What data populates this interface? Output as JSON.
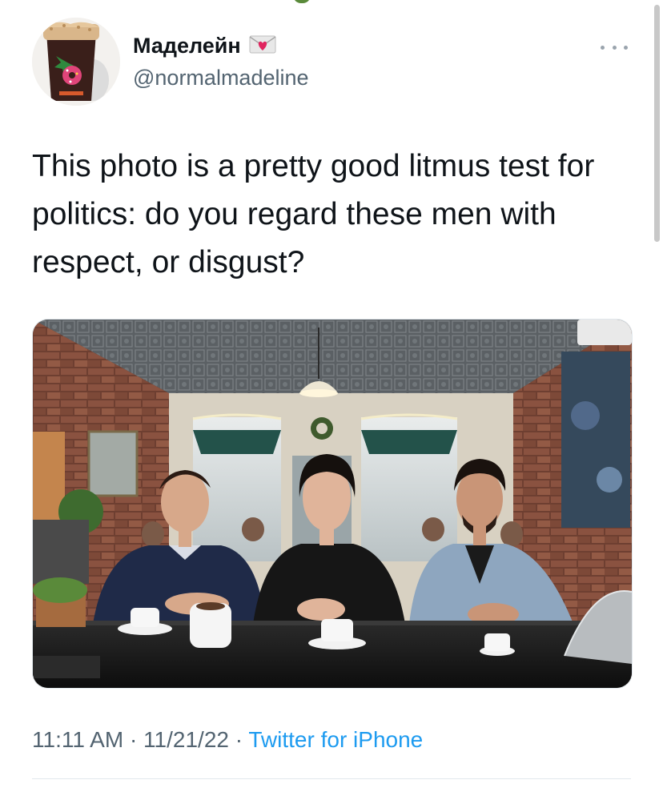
{
  "tweet": {
    "display_name": "Маделейн",
    "handle": "@normalmadeline",
    "text": "This photo is a pretty good litmus test for politics: do you regard these men with respect, or disgust?",
    "time": "11:11 AM",
    "date": "11/21/22",
    "separator": "·",
    "source": "Twitter for iPhone"
  },
  "icons": {
    "badge": "heart-envelope-icon",
    "more": "more-dots-icon",
    "avatar": "iced-coffee-cup-avatar"
  },
  "colors": {
    "text": "#0f1419",
    "secondary": "#536471",
    "link": "#1d9bf0",
    "badge_heart": "#e0245e"
  }
}
